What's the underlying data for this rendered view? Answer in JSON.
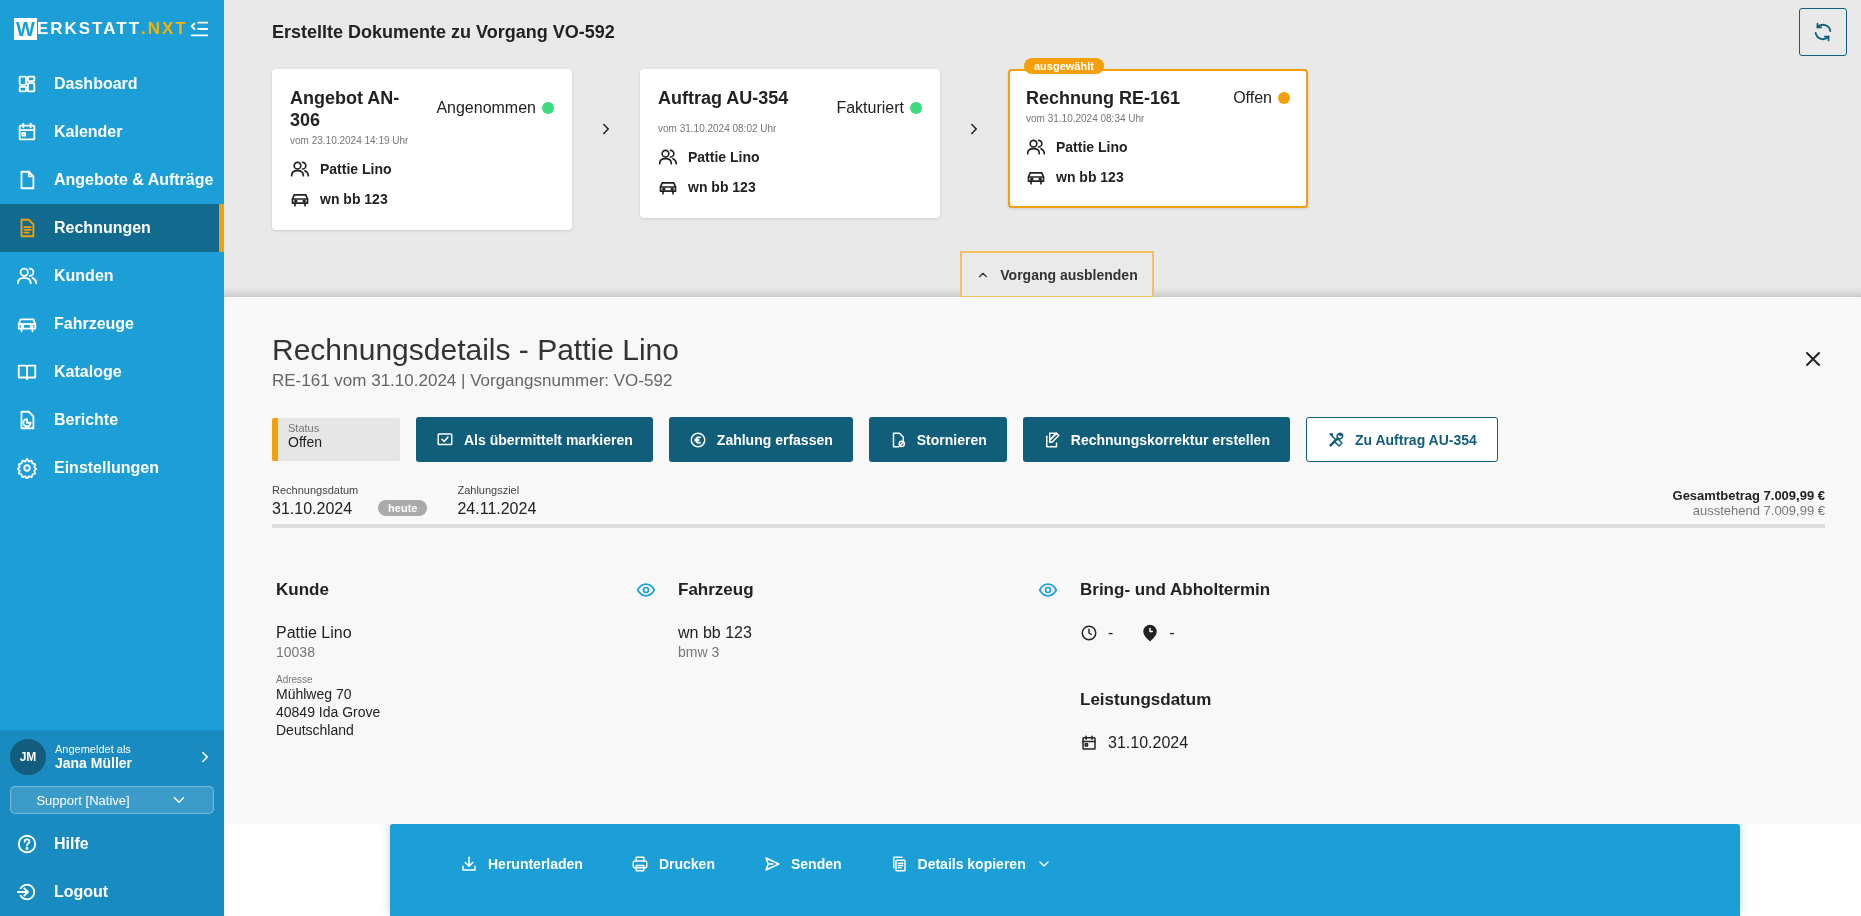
{
  "sidebar": {
    "logo": {
      "initial": "W",
      "name": "ERKSTATT",
      "suffix": ".NXT"
    },
    "nav": [
      {
        "label": "Dashboard",
        "selected": false
      },
      {
        "label": "Kalender",
        "selected": false
      },
      {
        "label": "Angebote & Aufträge",
        "selected": false
      },
      {
        "label": "Rechnungen",
        "selected": true
      },
      {
        "label": "Kunden",
        "selected": false
      },
      {
        "label": "Fahrzeuge",
        "selected": false
      },
      {
        "label": "Kataloge",
        "selected": false
      },
      {
        "label": "Berichte",
        "selected": false
      },
      {
        "label": "Einstellungen",
        "selected": false
      }
    ],
    "user": {
      "initials": "JM",
      "caption": "Angemeldet als",
      "name": "Jana Müller"
    },
    "role": {
      "value": "Support [Native]"
    },
    "footer": [
      {
        "label": "Hilfe"
      },
      {
        "label": "Logout"
      }
    ]
  },
  "process": {
    "title": "Erstellte Dokumente zu Vorgang VO-592",
    "cards": [
      {
        "title": "Angebot AN-306",
        "status": "Angenommen",
        "color": "#3ddc84",
        "date": "vom 23.10.2024 14:19 Uhr",
        "customer": "Pattie Lino",
        "vehicle": "wn bb 123",
        "selected": false
      },
      {
        "title": "Auftrag AU-354",
        "status": "Fakturiert",
        "color": "#3ddc84",
        "date": "vom 31.10.2024 08:02 Uhr",
        "customer": "Pattie Lino",
        "vehicle": "wn bb 123",
        "selected": false
      },
      {
        "title": "Rechnung RE-161",
        "status": "Offen",
        "color": "#f5a00a",
        "date": "vom 31.10.2024 08:34 Uhr",
        "customer": "Pattie Lino",
        "vehicle": "wn bb 123",
        "selected": true,
        "badge": "ausgewählt"
      }
    ],
    "toggle": "Vorgang ausblenden"
  },
  "details": {
    "title": "Rechnungsdetails - Pattie Lino",
    "subtitle": "RE-161 vom 31.10.2024 | Vorgangsnummer: VO-592",
    "status": {
      "label": "Status",
      "value": "Offen"
    },
    "actions": [
      {
        "label": "Als übermittelt markieren",
        "kind": "primary"
      },
      {
        "label": "Zahlung erfassen",
        "kind": "primary"
      },
      {
        "label": "Stornieren",
        "kind": "primary"
      },
      {
        "label": "Rechnungskorrektur erstellen",
        "kind": "primary"
      },
      {
        "label": "Zu Auftrag AU-354",
        "kind": "outline"
      }
    ],
    "dates": [
      {
        "label": "Rechnungsdatum",
        "value": "31.10.2024",
        "badge": "heute"
      },
      {
        "label": "Zahlungsziel",
        "value": "24.11.2024"
      }
    ],
    "totals": {
      "total": "Gesamtbetrag 7.009,99 €",
      "outstanding": "ausstehend 7.009,99 €"
    },
    "customer": {
      "heading": "Kunde",
      "name": "Pattie Lino",
      "number": "10038",
      "address_label": "Adresse",
      "address": [
        "Mühlweg 70",
        "40849 Ida Grove",
        "Deutschland"
      ]
    },
    "vehicle": {
      "heading": "Fahrzeug",
      "plate": "wn bb 123",
      "model": "bmw 3"
    },
    "appointment": {
      "heading": "Bring- und Abholtermin",
      "bring": "-",
      "pickup": "-"
    },
    "service_date": {
      "heading": "Leistungsdatum",
      "value": "31.10.2024"
    }
  },
  "toolbar": [
    {
      "label": "Herunterladen",
      "dropdown": false
    },
    {
      "label": "Drucken",
      "dropdown": false
    },
    {
      "label": "Senden",
      "dropdown": false
    },
    {
      "label": "Details kopieren",
      "dropdown": true
    }
  ]
}
